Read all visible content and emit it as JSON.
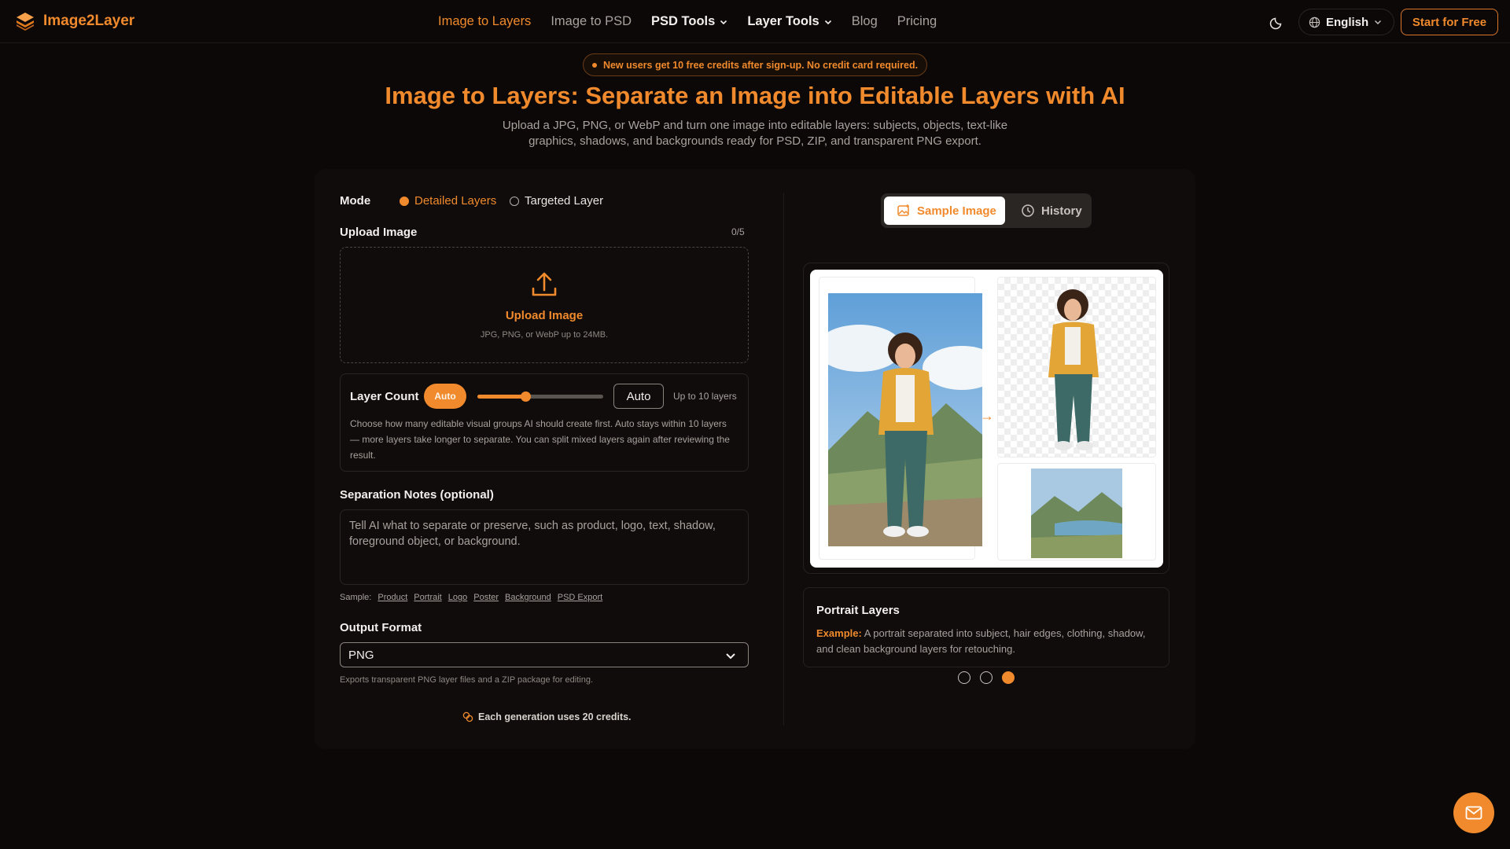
{
  "brand": {
    "name": "Image2Layer",
    "accent": "#f08a2c"
  },
  "nav": {
    "items": [
      {
        "label": "Image to Layers",
        "active": true
      },
      {
        "label": "Image to PSD"
      },
      {
        "label": "PSD Tools",
        "dropdown": true
      },
      {
        "label": "Layer Tools",
        "dropdown": true
      },
      {
        "label": "Blog"
      },
      {
        "label": "Pricing"
      }
    ],
    "language": "English",
    "cta": "Start for Free"
  },
  "hero": {
    "promo": "New users get 10 free credits after sign-up. No credit card required.",
    "title": "Image to Layers: Separate an Image into Editable Layers with AI",
    "subtitle": "Upload a JPG, PNG, or WebP and turn one image into editable layers: subjects, objects, text-like graphics, shadows, and backgrounds ready for PSD, ZIP, and transparent PNG export."
  },
  "form": {
    "mode_label": "Mode",
    "modes": [
      {
        "label": "Detailed Layers",
        "selected": true
      },
      {
        "label": "Targeted Layer",
        "selected": false
      }
    ],
    "upload_label": "Upload Image",
    "upload_count": "0/5",
    "upload_title": "Upload Image",
    "upload_hint": "JPG, PNG, or WebP up to 24MB.",
    "layer_count": {
      "label": "Layer Count",
      "pill": "Auto",
      "slider_fraction": 0.38,
      "value": "Auto",
      "limit": "Up to 10 layers",
      "description": "Choose how many editable visual groups AI should create first. Auto stays within 10 layers — more layers take longer to separate. You can split mixed layers again after reviewing the result."
    },
    "notes_label": "Separation Notes (optional)",
    "notes_placeholder": "Tell AI what to separate or preserve, such as product, logo, text, shadow, foreground object, or background.",
    "sample_label": "Sample:",
    "samples": [
      "Product",
      "Portrait",
      "Logo",
      "Poster",
      "Background",
      "PSD Export"
    ],
    "output_label": "Output Format",
    "output_value": "PNG",
    "output_hint": "Exports transparent PNG layer files and a ZIP package for editing.",
    "credits": "Each generation uses 20 credits."
  },
  "preview": {
    "tabs": [
      {
        "label": "Sample Image",
        "active": true,
        "icon": "image-sparkle-icon"
      },
      {
        "label": "History",
        "active": false,
        "icon": "clock-icon"
      }
    ],
    "arrow": "→",
    "info_title": "Portrait Layers",
    "info_prefix": "Example:",
    "info_text": "A portrait separated into subject, hair edges, clothing, shadow, and clean background layers for retouching.",
    "pagination": {
      "count": 3,
      "active": 3
    }
  }
}
